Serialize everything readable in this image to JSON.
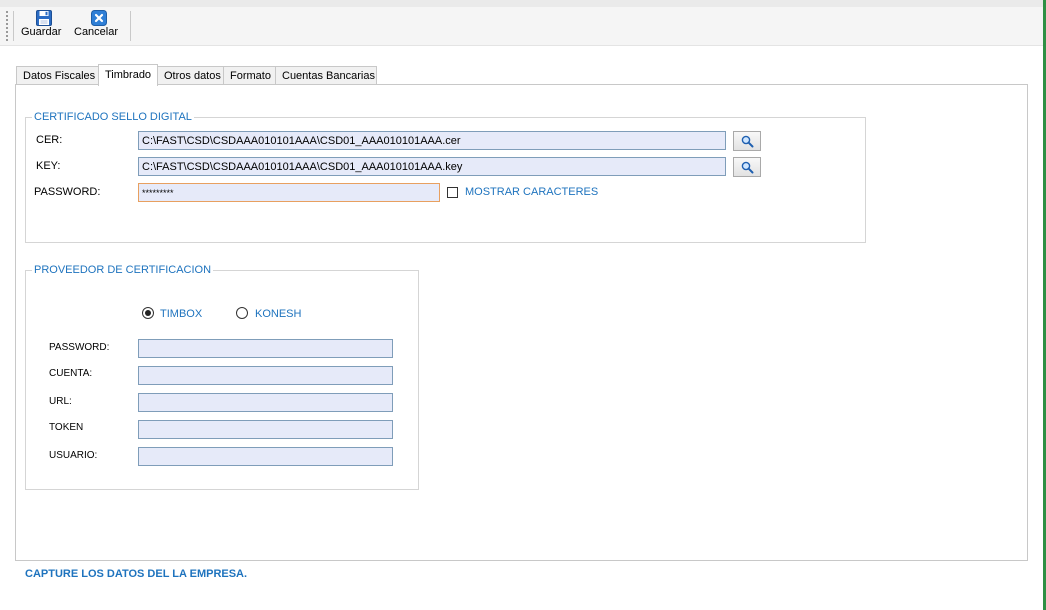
{
  "toolbar": {
    "guardar_label": "Guardar",
    "cancelar_label": "Cancelar"
  },
  "tabs": [
    {
      "label": "Datos Fiscales"
    },
    {
      "label": "Timbrado"
    },
    {
      "label": "Otros datos"
    },
    {
      "label": "Formato"
    },
    {
      "label": "Cuentas Bancarias"
    }
  ],
  "active_tab": "Timbrado",
  "certificado": {
    "title": "CERTIFICADO SELLO DIGITAL",
    "cer_label": "CER:",
    "cer_value": "C:\\FAST\\CSD\\CSDAAA010101AAA\\CSD01_AAA010101AAA.cer",
    "key_label": "KEY:",
    "key_value": "C:\\FAST\\CSD\\CSDAAA010101AAA\\CSD01_AAA010101AAA.key",
    "password_label": "PASSWORD:",
    "password_value": "*********",
    "mostrar_label": "MOSTRAR CARACTERES",
    "mostrar_checked": false
  },
  "proveedor": {
    "title": "PROVEEDOR DE CERTIFICACION",
    "options": [
      "TIMBOX",
      "KONESH"
    ],
    "selected": "TIMBOX",
    "password_label": "PASSWORD:",
    "password_value": "",
    "cuenta_label": "CUENTA:",
    "cuenta_value": "",
    "url_label": "URL:",
    "url_value": "",
    "token_label": "TOKEN",
    "token_value": "",
    "usuario_label": "USUARIO:",
    "usuario_value": ""
  },
  "status_text": "CAPTURE LOS DATOS DEL LA EMPRESA.",
  "colors": {
    "accent": "#1e73be",
    "field_bg": "#e6eaf9",
    "window_edge": "#2f8f44"
  }
}
